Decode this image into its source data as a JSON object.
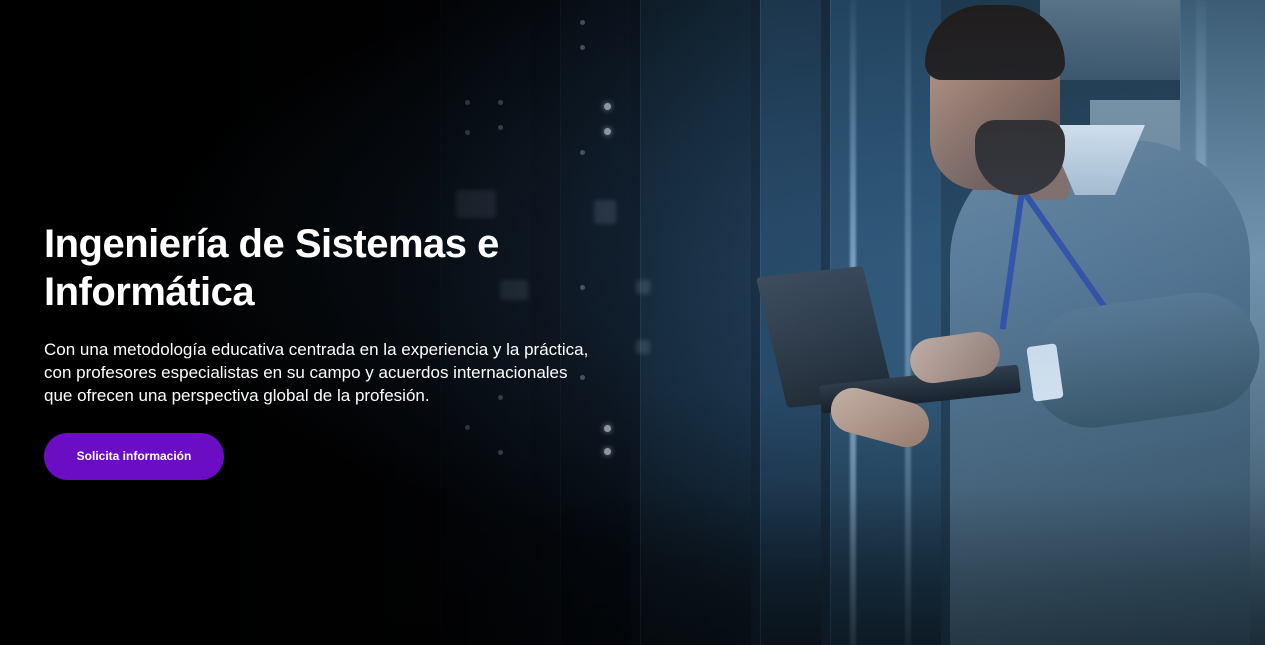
{
  "hero": {
    "title_line1": "Ingeniería de Sistemas e",
    "title_line2": "Informática",
    "description": "Con una metodología educativa centrada en la experiencia y la práctica, con profesores especialistas en su campo y acuerdos internacionales que ofrecen una perspectiva global de la profesión.",
    "cta_label": "Solicita información",
    "image_subject": "man-with-laptop-in-server-room-photo"
  },
  "colors": {
    "cta_background": "#6a0dc4",
    "title_text": "#ffffff",
    "background": "#000000"
  }
}
